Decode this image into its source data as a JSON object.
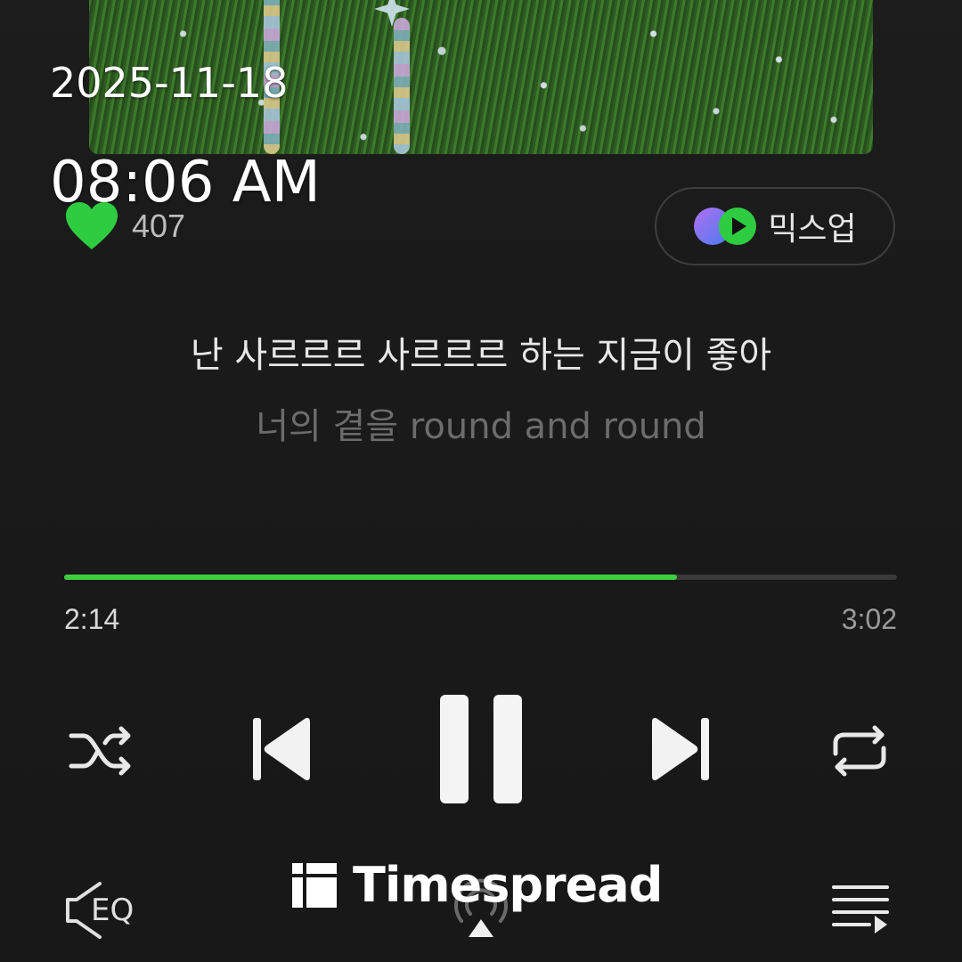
{
  "overlay": {
    "date": "2025-11-18",
    "time": "08:06 AM"
  },
  "like": {
    "icon": "heart-icon",
    "count": "407",
    "color": "#2ecc40"
  },
  "mixup": {
    "label": "믹스업",
    "icon": "mixup-icon"
  },
  "lyrics": {
    "current": "난 사르르르 사르르르 하는 지금이 좋아",
    "next": "너의 곁을 round and round"
  },
  "progress": {
    "elapsed": "2:14",
    "total": "3:02",
    "fraction": 0.736,
    "accent": "#3ecf3e"
  },
  "controls": {
    "shuffle": "shuffle-icon",
    "previous": "skip-previous-icon",
    "play_state": "pause-icon",
    "next": "skip-next-icon",
    "repeat": "repeat-icon"
  },
  "bottom_bar": {
    "eq": "EQ",
    "airplay": "airplay-icon",
    "queue": "playlist-icon"
  },
  "watermark": {
    "text": "Timespread",
    "icon": "timespread-logo-icon"
  }
}
